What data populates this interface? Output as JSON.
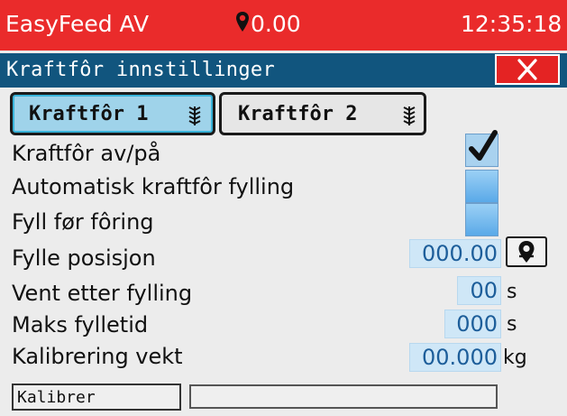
{
  "status_bar": {
    "app_title": "EasyFeed AV",
    "position_value": "0.00",
    "time": "12:35:18",
    "colors": {
      "background": "#ea2b2b",
      "text": "#ffffff"
    },
    "icons": {
      "location": "map-pin-icon"
    }
  },
  "title_bar": {
    "title": "Kraftfôr innstillinger",
    "colors": {
      "background": "#11557e"
    },
    "close_icon": "close-icon"
  },
  "tabs": [
    {
      "label": "Kraftfôr 1",
      "icon": "wheat-icon",
      "selected": true
    },
    {
      "label": "Kraftfôr 2",
      "icon": "wheat-icon",
      "selected": false
    }
  ],
  "settings": {
    "feed_on_off": {
      "label": "Kraftfôr av/på",
      "checked": true
    },
    "auto_fill": {
      "label": "Automatisk kraftfôr fylling",
      "checked": false
    },
    "fill_before_feeding": {
      "label": "Fyll før fôring",
      "checked": false
    },
    "fill_position": {
      "label": "Fylle posisjon",
      "value": "000.00",
      "button_icon": "location-pin-button-icon"
    },
    "wait_after_fill": {
      "label": "Vent etter fylling",
      "value": "00",
      "unit": "s"
    },
    "max_fill_time": {
      "label": "Maks fylletid",
      "value": "000",
      "unit": "s"
    },
    "calibration_weight": {
      "label": "Kalibrering vekt",
      "value": "00.000",
      "unit": "kg"
    }
  },
  "calibrate": {
    "button_label": "Kalibrer",
    "progress": 0
  }
}
